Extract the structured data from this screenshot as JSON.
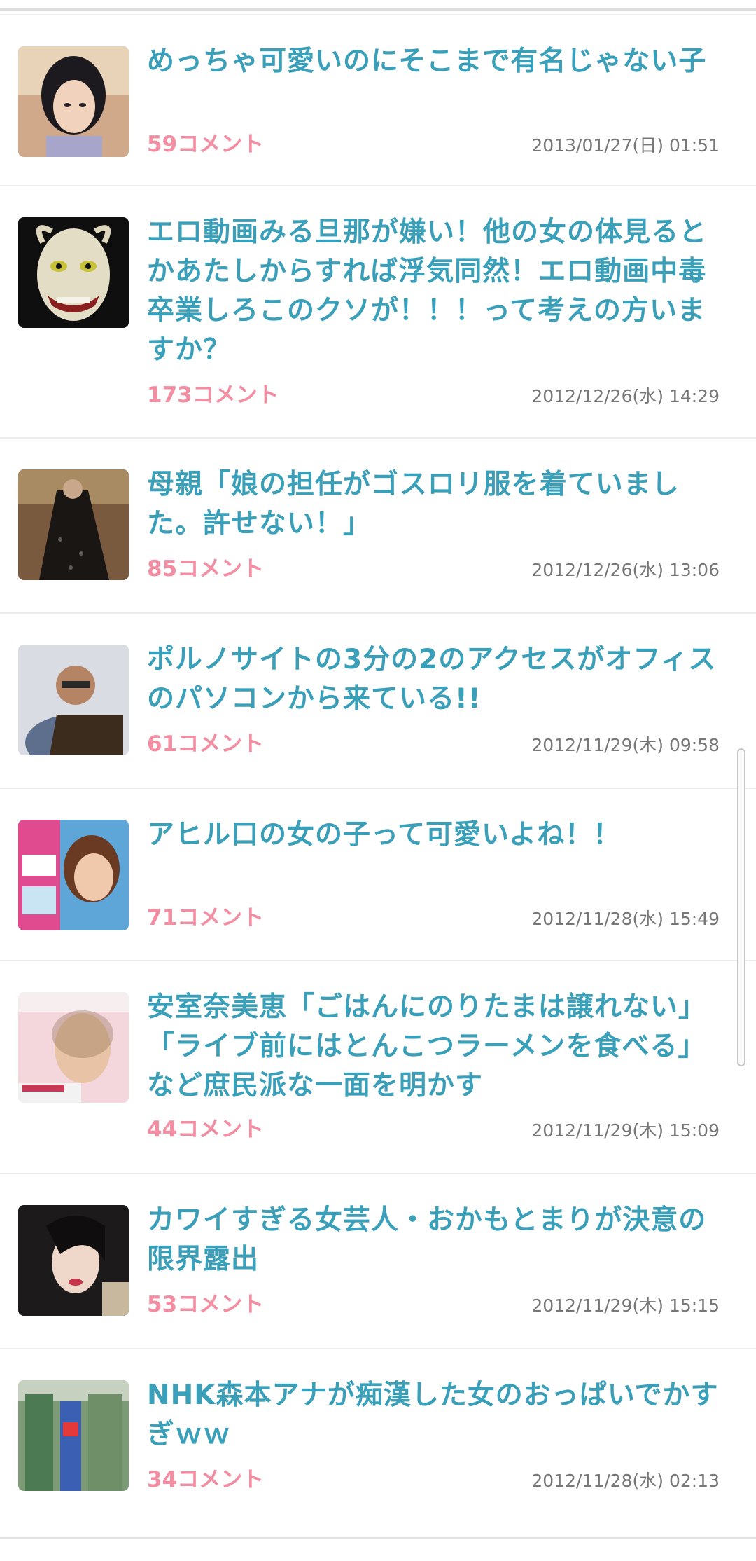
{
  "articles": [
    {
      "title": "めっちゃ可愛いのにそこまで有名じゃない子",
      "comments": "59コメント",
      "date": "2013/01/27(日) 01:51",
      "thumb": "girl-portrait-icon"
    },
    {
      "title": "エロ動画みる旦那が嫌い！他の女の体見るとかあたしからすれば浮気同然！エロ動画中毒卒業しろこのクソが！！！って考えの方いますか？",
      "comments": "173コメント",
      "date": "2012/12/26(水) 14:29",
      "thumb": "hannya-mask-icon"
    },
    {
      "title": "母親「娘の担任がゴスロリ服を着ていました。許せない！」",
      "comments": "85コメント",
      "date": "2012/12/26(水) 13:06",
      "thumb": "gothic-dress-icon"
    },
    {
      "title": "ポルノサイトの3分の2のアクセスがオフィスのパソコンから来ている!!",
      "comments": "61コメント",
      "date": "2012/11/29(木) 09:58",
      "thumb": "man-laptop-icon"
    },
    {
      "title": "アヒル口の女の子って可愛いよね！！",
      "comments": "71コメント",
      "date": "2012/11/28(水) 15:49",
      "thumb": "magazine-girl-icon"
    },
    {
      "title": "安室奈美恵「ごはんにのりたまは譲れない」「ライブ前にはとんこつラーメンを食べる」など庶民派な一面を明かす",
      "comments": "44コメント",
      "date": "2012/11/29(木) 15:09",
      "thumb": "magazine-cover-icon"
    },
    {
      "title": "カワイすぎる女芸人・おかもとまりが決意の限界露出",
      "comments": "53コメント",
      "date": "2012/11/29(木) 15:15",
      "thumb": "woman-portrait-icon"
    },
    {
      "title": "NHK森本アナが痴漢した女のおっぱいでかすぎｗｗ",
      "comments": "34コメント",
      "date": "2012/11/28(水) 02:13",
      "thumb": "train-scene-icon"
    }
  ]
}
